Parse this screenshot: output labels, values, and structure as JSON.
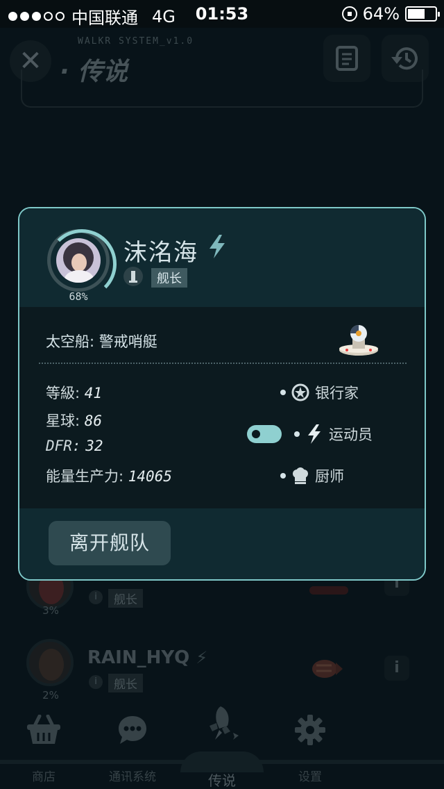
{
  "status_bar": {
    "carrier": "中国联通",
    "network": "4G",
    "time": "01:53",
    "battery": "64%",
    "battery_level": 0.64
  },
  "header": {
    "system_label": "WALKR SYSTEM_v1.0",
    "title": "· 传说",
    "close_icon": "close-icon",
    "doc_icon": "document-icon",
    "history_icon": "history-icon"
  },
  "background_list": [
    {
      "name": "",
      "role": "舰长",
      "percent": "3%"
    },
    {
      "name": "RAIN_HYQ",
      "role": "舰长",
      "percent": "2%"
    }
  ],
  "modal": {
    "avatar_progress": 0.68,
    "percent": "68%",
    "name": "沫洺海",
    "role": "舰长",
    "ship_label": "太空船:",
    "ship_name": "警戒哨艇",
    "stats": [
      {
        "key": "等級:",
        "value": "41"
      },
      {
        "key": "星球:",
        "value": "86"
      },
      {
        "key": "DFR:",
        "value": "32"
      },
      {
        "key": "能量生产力:",
        "value": "14065"
      }
    ],
    "skills": [
      {
        "label": "银行家",
        "icon": "star-badge-icon"
      },
      {
        "label": "运动员",
        "icon": "bolt-icon"
      },
      {
        "label": "厨师",
        "icon": "chef-hat-icon"
      }
    ],
    "leave_button": "离开舰队"
  },
  "tabbar": {
    "tabs": [
      {
        "label": "商店",
        "icon": "basket-icon"
      },
      {
        "label": "通讯系统",
        "icon": "chat-icon"
      },
      {
        "label": "传说",
        "icon": "rocket-icon"
      },
      {
        "label": "设置",
        "icon": "gear-icon"
      }
    ],
    "active": "传说"
  },
  "colors": {
    "accent": "#7fc9c9",
    "background": "#0c1a1f",
    "modal_header": "#102a31"
  }
}
